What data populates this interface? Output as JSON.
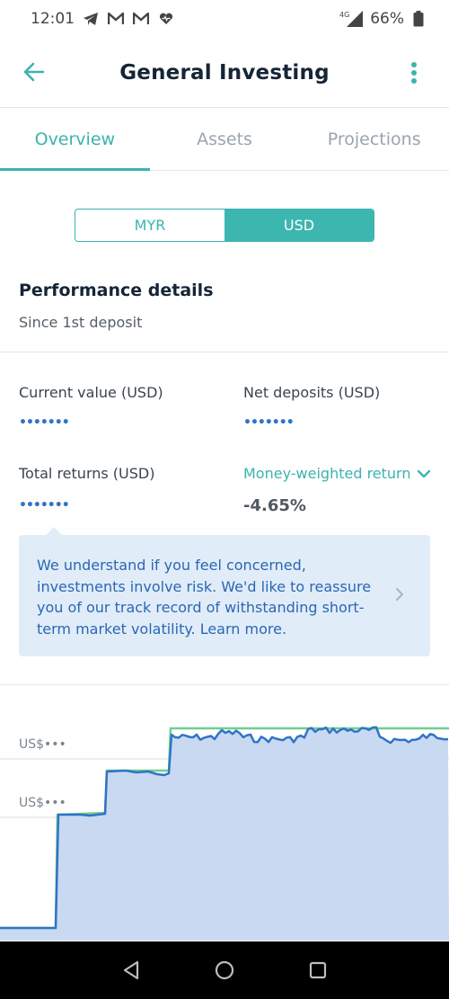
{
  "status_bar": {
    "time": "12:01",
    "network": "4G",
    "battery": "66%",
    "icons": [
      "telegram-icon",
      "gmail-icon",
      "gmail-icon",
      "heart-icon",
      "signal-icon",
      "battery-icon"
    ]
  },
  "app_bar": {
    "title": "General Investing",
    "back_icon": "arrow-left-icon",
    "menu_icon": "more-vertical-icon"
  },
  "tabs": [
    {
      "label": "Overview",
      "active": true
    },
    {
      "label": "Assets",
      "active": false
    },
    {
      "label": "Projections",
      "active": false
    }
  ],
  "currency_toggle": {
    "options": [
      "MYR",
      "USD"
    ],
    "selected": "USD"
  },
  "performance": {
    "title": "Performance details",
    "subtitle": "Since 1st deposit",
    "current_value": {
      "label": "Current value (USD)",
      "value": "•••••••"
    },
    "net_deposits": {
      "label": "Net deposits (USD)",
      "value": "•••••••"
    },
    "total_returns": {
      "label": "Total returns (USD)",
      "value": "•••••••"
    },
    "return_metric": {
      "label": "Money-weighted return",
      "value": "-4.65%",
      "icon": "chevron-down-icon"
    }
  },
  "notice": {
    "text": "We understand if you feel concerned, investments involve risk. We'd like to reassure you of our track record of withstanding short-term market volatility. Learn more.",
    "icon": "chevron-right-icon"
  },
  "chart": {
    "y_labels": [
      "US$•••",
      "US$•••"
    ],
    "colors": {
      "value_line": "#2f74c7",
      "deposit_line": "#6fcf8f",
      "fill": "#c9d9f1",
      "grid": "#d9dde2"
    }
  },
  "nav_bar": {
    "icons": [
      "back-triangle-icon",
      "home-circle-icon",
      "recents-square-icon"
    ]
  },
  "colors": {
    "accent": "#3bb3ae",
    "title": "#152536",
    "link_blue": "#2a67b3",
    "notice_bg": "#e1ecf9"
  }
}
